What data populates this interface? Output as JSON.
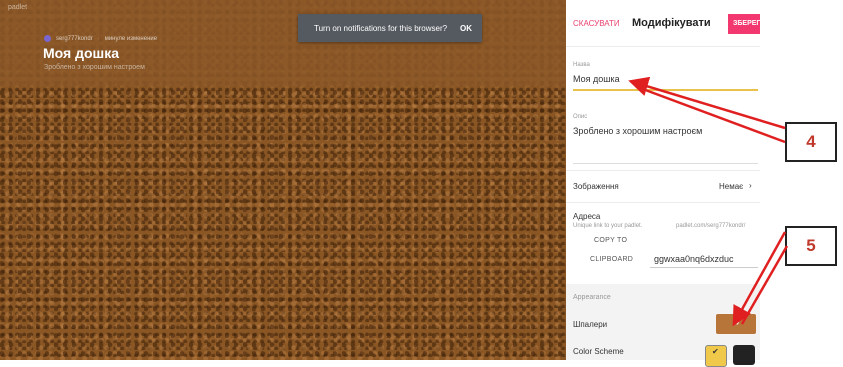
{
  "board": {
    "logo": "padlet",
    "author": "serg777kondr",
    "meta": "минуле изменение",
    "title": "Моя дошка",
    "subtitle": "Зроблено з хорошим настроем"
  },
  "notification": {
    "text": "Turn on notifications for this browser?",
    "ok_label": "OK"
  },
  "panel": {
    "cancel_label": "СКАСУВАТИ",
    "title": "Модифікувати",
    "save_label": "ЗБЕРЕГТИ",
    "name_label": "Назва",
    "name_value": "Моя дошка",
    "desc_label": "Опис",
    "desc_value": "Зроблено з хорошим настроєм",
    "image_label": "Зображення",
    "image_value": "Немає",
    "address_label": "Адреса",
    "address_hint": "Unique link to your padlet.",
    "address_prefix": "padlet.com/serg777kondr/",
    "copy_to": "COPY TO",
    "clipboard": "CLIPBOARD",
    "slug": "ggwxaa0nq6dxzduc",
    "appearance_label": "Appearance",
    "wallpaper_label": "Шпалери",
    "color_scheme_label": "Color Scheme"
  },
  "callouts": {
    "four": "4",
    "five": "5"
  },
  "colors": {
    "accent": "#e8416e",
    "save_bg": "#f2386e",
    "board_bg": "#8a5624",
    "wallpaper_swatch": "#b8753a"
  },
  "icons": {
    "chevron_right": "›",
    "check": "✔"
  }
}
